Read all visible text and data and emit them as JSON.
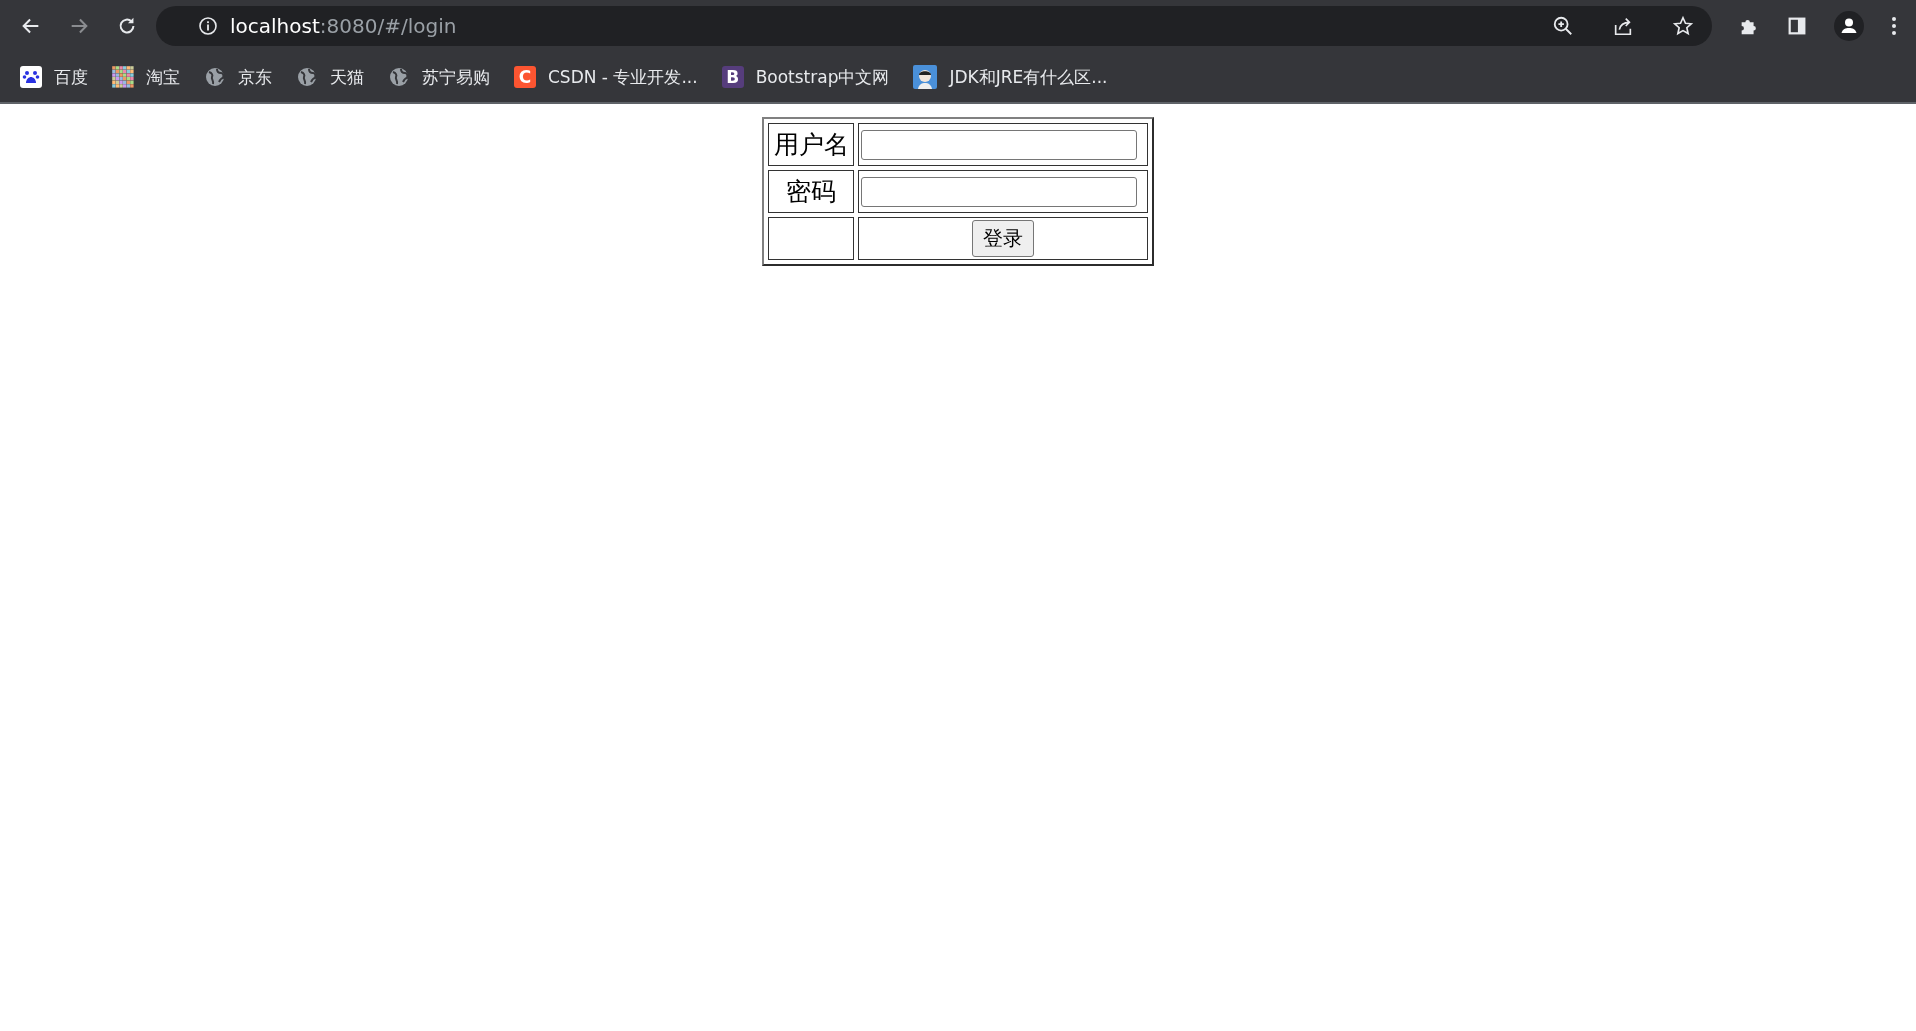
{
  "browser": {
    "address": {
      "host": "localhost",
      "path": ":8080/#/login"
    },
    "bookmarks": [
      {
        "kind": "paw",
        "label": "百度"
      },
      {
        "kind": "mosaic",
        "label": "淘宝"
      },
      {
        "kind": "globe",
        "label": "京东"
      },
      {
        "kind": "globe",
        "label": "天猫"
      },
      {
        "kind": "globe",
        "label": "苏宁易购"
      },
      {
        "kind": "letter",
        "icon_text": "C",
        "color": "#fc5531",
        "label": "CSDN - 专业开发..."
      },
      {
        "kind": "letter",
        "icon_text": "B",
        "color": "#563d7c",
        "label": "Bootstrap中文网"
      },
      {
        "kind": "avatar",
        "label": "JDK和JRE有什么区..."
      }
    ]
  },
  "login_form": {
    "rows": [
      {
        "kind": "input",
        "label": "用户名"
      },
      {
        "kind": "input",
        "label": "密码"
      },
      {
        "kind": "button",
        "button": "登录"
      }
    ]
  }
}
